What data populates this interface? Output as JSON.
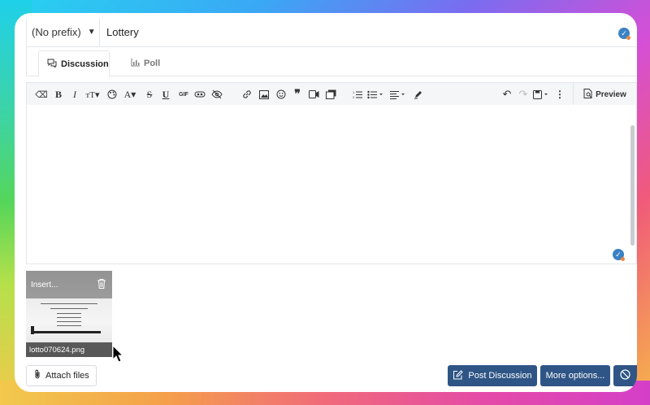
{
  "thread": {
    "prefix": "(No prefix)",
    "title_value": "Lottery"
  },
  "tabs": [
    {
      "label": "Discussion",
      "icon": "discussion-icon"
    },
    {
      "label": "Poll",
      "icon": "poll-icon"
    }
  ],
  "toolbar": {
    "gif_label": "GIF",
    "preview_label": "Preview"
  },
  "attachment": {
    "insert_label": "Insert...",
    "filename": "lotto070624.png"
  },
  "actions": {
    "attach_label": "Attach files",
    "post_label": "Post Discussion",
    "more_label": "More options..."
  },
  "colors": {
    "primary": "#2e5585",
    "check": "#3b82c4"
  }
}
